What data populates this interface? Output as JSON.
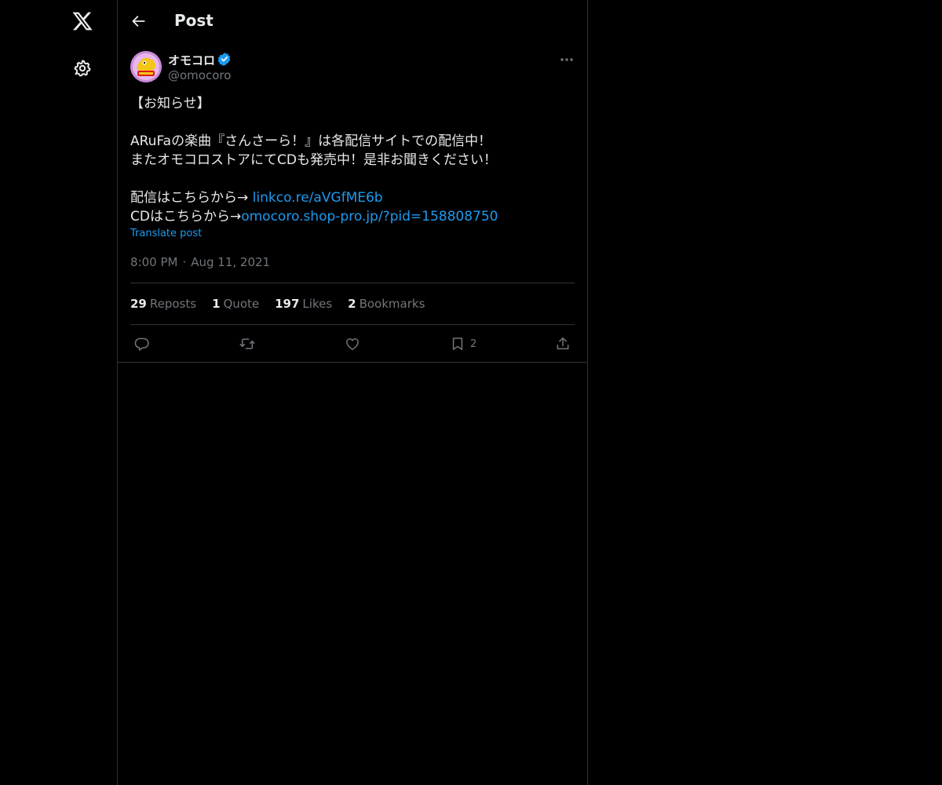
{
  "nav": {
    "logo_icon": "x-logo-icon",
    "settings_icon": "gear-icon"
  },
  "topbar": {
    "title": "Post",
    "back_icon": "arrow-left-icon"
  },
  "post": {
    "author_name": "オモコロ",
    "author_handle": "@omocoro",
    "verified": true,
    "body_line1": "【お知らせ】",
    "body_line2": "ARuFaの楽曲『さんさーら！』は各配信サイトでの配信中！",
    "body_line3": "またオモコロストアにてCDも発売中！是非お聞きください！",
    "body_line4_prefix": "配信はこちらから→ ",
    "body_line4_link": "linkco.re/aVGfME6b",
    "body_line5_prefix": "CDはこちらから→",
    "body_line5_link": "omocoro.shop-pro.jp/?pid=158808750",
    "translate_label": "Translate post",
    "time": "8:00 PM",
    "date": "Aug 11, 2021",
    "meta_separator": "·"
  },
  "stats": {
    "reposts_count": "29",
    "reposts_label": "Reposts",
    "quotes_count": "1",
    "quotes_label": "Quote",
    "likes_count": "197",
    "likes_label": "Likes",
    "bookmarks_count": "2",
    "bookmarks_label": "Bookmarks"
  },
  "actions": {
    "reply_icon": "reply-icon",
    "repost_icon": "repost-icon",
    "like_icon": "heart-icon",
    "bookmark_icon": "bookmark-icon",
    "bookmark_count": "2",
    "share_icon": "share-icon"
  },
  "colors": {
    "background": "#000000",
    "text": "#e7e9ea",
    "muted": "#71767b",
    "accent": "#1d9bf0",
    "border": "#2f3336"
  }
}
